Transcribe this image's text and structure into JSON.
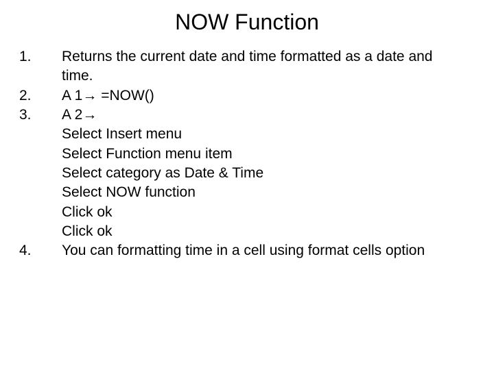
{
  "title": "NOW Function",
  "items": [
    {
      "num": "1.",
      "text": "Returns the current date and time formatted as a date and time."
    },
    {
      "num": "2.",
      "text": "A 1→ =NOW()"
    },
    {
      "num": "3.",
      "text": "A 2→"
    },
    {
      "num": "4.",
      "text": "You can formatting time in a cell using format cells option"
    }
  ],
  "sub_steps": [
    "Select Insert menu",
    "Select Function menu item",
    "Select category as Date & Time",
    "Select NOW function",
    "Click ok",
    "Click ok"
  ]
}
